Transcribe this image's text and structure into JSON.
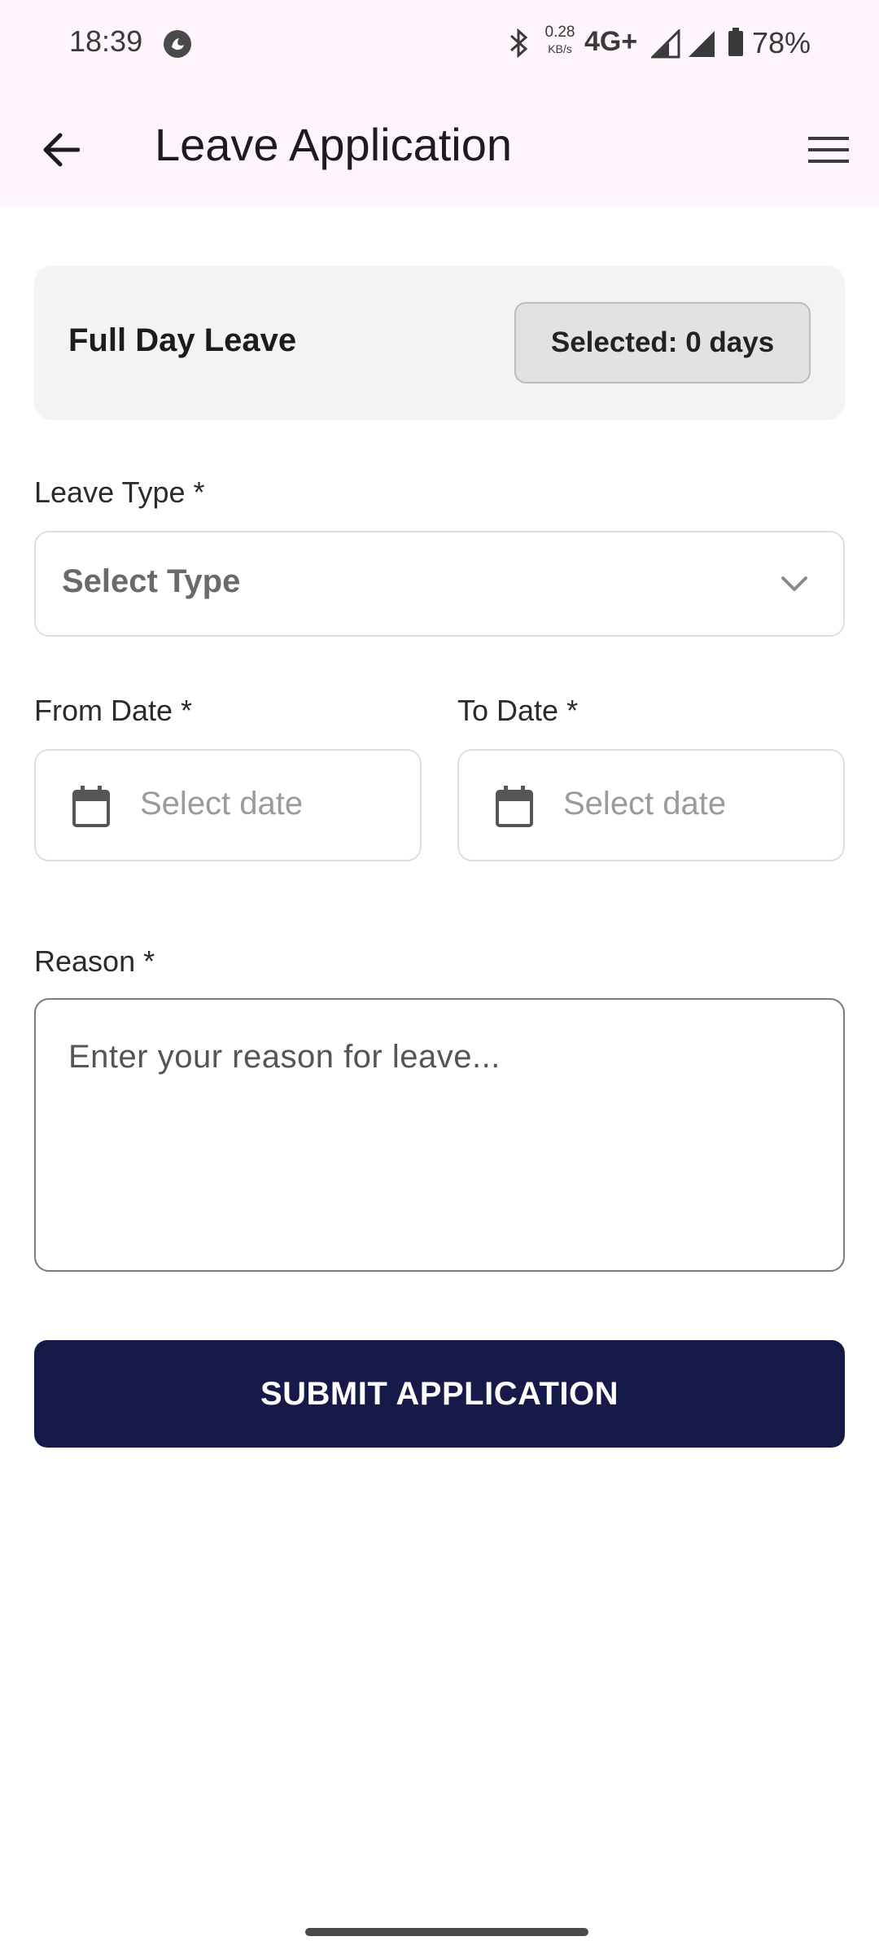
{
  "status_bar": {
    "time": "18:39",
    "net_speed": "0.28",
    "net_speed_unit": "KB/s",
    "network": "4G+",
    "battery": "78%",
    "icons": [
      "alert-icon",
      "bluetooth-icon",
      "signal-icon",
      "battery-icon"
    ]
  },
  "app_bar": {
    "title": "Leave Application",
    "back_icon": "arrow-left-icon",
    "menu_icon": "hamburger-menu-icon"
  },
  "leave_card": {
    "title": "Full Day Leave",
    "selected_label": "Selected: 0 days"
  },
  "leave_type": {
    "label": "Leave Type *",
    "placeholder": "Select Type",
    "icon": "chevron-down-icon"
  },
  "from_date": {
    "label": "From Date *",
    "placeholder": "Select date",
    "icon": "calendar-icon"
  },
  "to_date": {
    "label": "To Date *",
    "placeholder": "Select date",
    "icon": "calendar-icon"
  },
  "reason": {
    "label": "Reason *",
    "placeholder": "Enter your reason for leave..."
  },
  "submit": {
    "label": "SUBMIT APPLICATION"
  },
  "colors": {
    "app_bar_bg": "#fdf5fb",
    "card_bg": "#f3f3f3",
    "submit_bg": "#161a48"
  }
}
